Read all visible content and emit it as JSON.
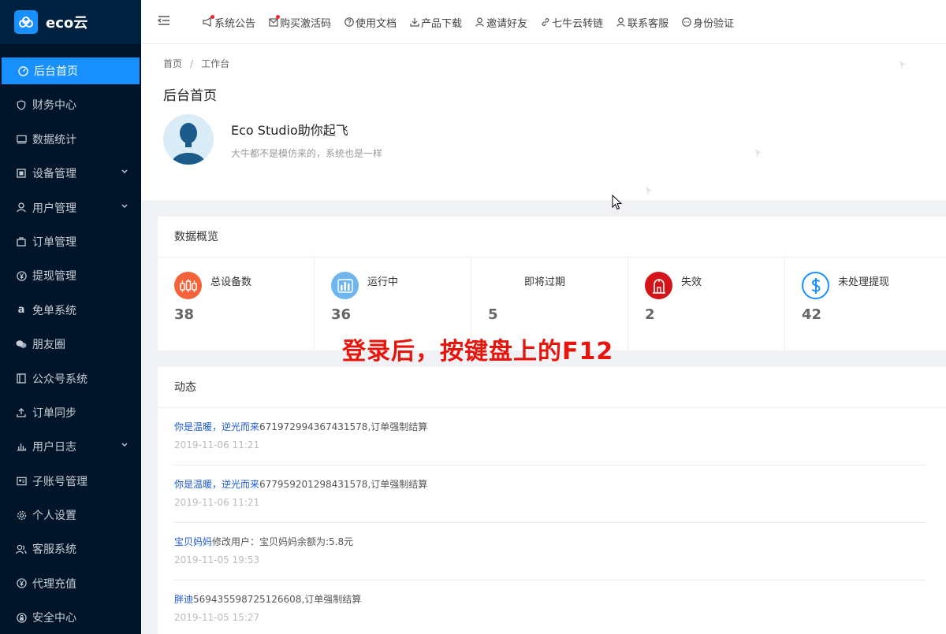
{
  "brand": {
    "name": "eco云"
  },
  "sidebar": {
    "items": [
      {
        "label": "后台首页",
        "icon": "dashboard-icon",
        "active": true,
        "expandable": false
      },
      {
        "label": "财务中心",
        "icon": "shield-icon",
        "active": false,
        "expandable": false
      },
      {
        "label": "数据统计",
        "icon": "monitor-icon",
        "active": false,
        "expandable": false
      },
      {
        "label": "设备管理",
        "icon": "device-icon",
        "active": false,
        "expandable": true
      },
      {
        "label": "用户管理",
        "icon": "user-icon",
        "active": false,
        "expandable": true
      },
      {
        "label": "订单管理",
        "icon": "bag-icon",
        "active": false,
        "expandable": false
      },
      {
        "label": "提现管理",
        "icon": "yen-circle-icon",
        "active": false,
        "expandable": false
      },
      {
        "label": "免单系统",
        "icon": "amazon-icon",
        "active": false,
        "expandable": false
      },
      {
        "label": "朋友圈",
        "icon": "wechat-icon",
        "active": false,
        "expandable": false
      },
      {
        "label": "公众号系统",
        "icon": "book-icon",
        "active": false,
        "expandable": false
      },
      {
        "label": "订单同步",
        "icon": "upload-icon",
        "active": false,
        "expandable": false
      },
      {
        "label": "用户日志",
        "icon": "chart-bars-icon",
        "active": false,
        "expandable": true
      },
      {
        "label": "子账号管理",
        "icon": "id-card-icon",
        "active": false,
        "expandable": false
      },
      {
        "label": "个人设置",
        "icon": "gear-icon",
        "active": false,
        "expandable": false
      },
      {
        "label": "客服系统",
        "icon": "users-icon",
        "active": false,
        "expandable": false
      },
      {
        "label": "代理充值",
        "icon": "yen-circle-icon",
        "active": false,
        "expandable": false
      },
      {
        "label": "安全中心",
        "icon": "lock-icon",
        "active": false,
        "expandable": false
      }
    ]
  },
  "topnav": {
    "items": [
      {
        "label": "系统公告",
        "icon": "megaphone-icon",
        "dot": true
      },
      {
        "label": "购买激活码",
        "icon": "mail-icon",
        "dot": true
      },
      {
        "label": "使用文档",
        "icon": "question-circle-icon",
        "dot": false
      },
      {
        "label": "产品下载",
        "icon": "download-icon",
        "dot": false
      },
      {
        "label": "邀请好友",
        "icon": "user-icon",
        "dot": false
      },
      {
        "label": "七牛云转链",
        "icon": "link-icon",
        "dot": false
      },
      {
        "label": "联系客服",
        "icon": "user-icon",
        "dot": false
      },
      {
        "label": "身份验证",
        "icon": "chat-icon",
        "dot": false
      }
    ]
  },
  "breadcrumb": {
    "home": "首页",
    "separator": "/",
    "current": "工作台"
  },
  "page": {
    "title": "后台首页",
    "welcome_title": "Eco Studio助你起飞",
    "welcome_sub": "大牛都不是模仿来的，系统也是一样"
  },
  "overview": {
    "title": "数据概览",
    "stats": [
      {
        "label": "总设备数",
        "value": "38",
        "icon": "devices-icon",
        "color": "#f4633b"
      },
      {
        "label": "运行中",
        "value": "36",
        "icon": "bar-chart-icon",
        "color": "#6fb5ee"
      },
      {
        "label": "即将过期",
        "value": "5",
        "icon": "",
        "color": ""
      },
      {
        "label": "失效",
        "value": "2",
        "icon": "door-icon",
        "color": "#d4131b"
      },
      {
        "label": "未处理提现",
        "value": "42",
        "icon": "dollar-icon",
        "color": "#1890ff"
      }
    ]
  },
  "overlay_caption": "登录后，按键盘上的F12",
  "activity": {
    "title": "动态",
    "items": [
      {
        "user": "你是温暖，逆光而来",
        "text": "671972994367431578,订单强制结算",
        "time": "2019-11-06 11:21"
      },
      {
        "user": "你是温暖，逆光而来",
        "text": "677959201298431578,订单强制结算",
        "time": "2019-11-06 11:21"
      },
      {
        "user": "宝贝妈妈",
        "text": "修改用户：宝贝妈妈余额为:5.8元",
        "time": "2019-11-05 19:53"
      },
      {
        "user": "胖迪",
        "text": "569435598725126608,订单强制结算",
        "time": "2019-11-05 15:27"
      }
    ]
  },
  "colors": {
    "sidebar_bg": "#001529",
    "accent": "#1890ff",
    "link": "#1f5bd8",
    "caption": "#e8150c"
  }
}
